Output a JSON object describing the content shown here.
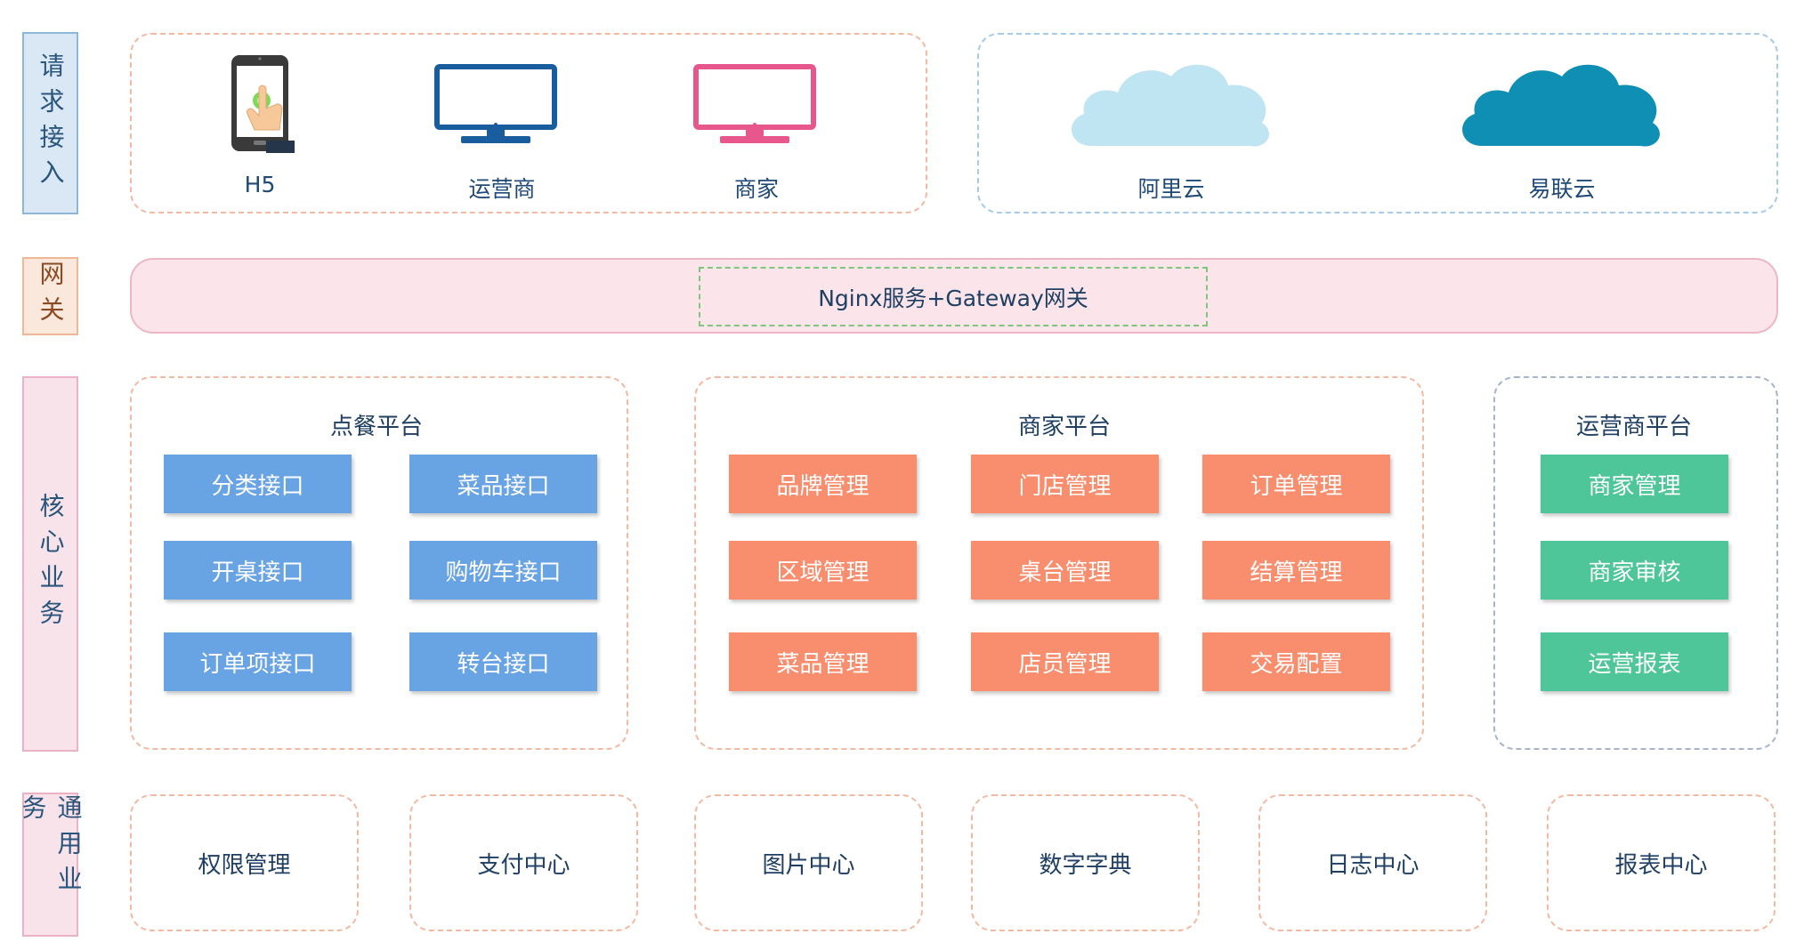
{
  "rows": {
    "request": "请求接入",
    "gateway": "网关",
    "core": "核心业务",
    "common": "通用业务"
  },
  "clients": [
    {
      "label": "H5",
      "icon": "phone-touch-icon"
    },
    {
      "label": "运营商",
      "icon": "monitor-icon",
      "color": "#1a5d9f"
    },
    {
      "label": "商家",
      "icon": "monitor-icon",
      "color": "#e8578c"
    }
  ],
  "clouds": [
    {
      "label": "阿里云",
      "icon": "cloud-icon",
      "color": "#bfe4f2"
    },
    {
      "label": "易联云",
      "icon": "cloud-icon",
      "color": "#0f8fb3"
    }
  ],
  "gateway": {
    "label": "Nginx服务+Gateway网关"
  },
  "platforms": {
    "ordering": {
      "title": "点餐平台",
      "items": [
        "分类接口",
        "菜品接口",
        "开桌接口",
        "购物车接口",
        "订单项接口",
        "转台接口"
      ],
      "color": "#68a3e3"
    },
    "merchant": {
      "title": "商家平台",
      "items": [
        "品牌管理",
        "门店管理",
        "订单管理",
        "区域管理",
        "桌台管理",
        "结算管理",
        "菜品管理",
        "店员管理",
        "交易配置"
      ],
      "color": "#f88e6e"
    },
    "operator": {
      "title": "运营商平台",
      "items": [
        "商家管理",
        "商家审核",
        "运营报表"
      ],
      "color": "#4fc59a"
    }
  },
  "common": [
    "权限管理",
    "支付中心",
    "图片中心",
    "数字字典",
    "日志中心",
    "报表中心"
  ]
}
